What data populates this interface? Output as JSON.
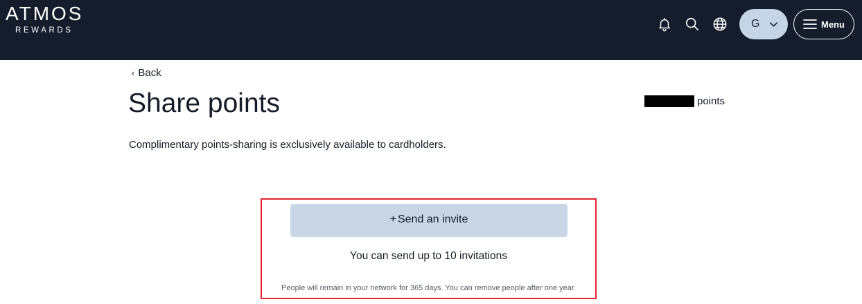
{
  "header": {
    "brand": "ATMOS",
    "brand_sub": "REWARDS",
    "icons": [
      "bell-icon",
      "search-icon",
      "globe-icon"
    ],
    "account_initial": "G",
    "menu_label": "Menu",
    "colors": {
      "background": "#151d2d",
      "account_button": "#c6d5e6"
    }
  },
  "nav": {
    "back_label": "Back"
  },
  "page": {
    "title": "Share points",
    "points_label": "points",
    "intro": "Complimentary points-sharing is exclusively available to cardholders."
  },
  "invite": {
    "button_label": "Send an invite",
    "count_text": "You can send up to 10 invitations",
    "note": "People will remain in your network for 365 days. You can remove people after one year.",
    "colors": {
      "button": "#c9d6e5",
      "highlight_border": "#e0232d"
    }
  }
}
